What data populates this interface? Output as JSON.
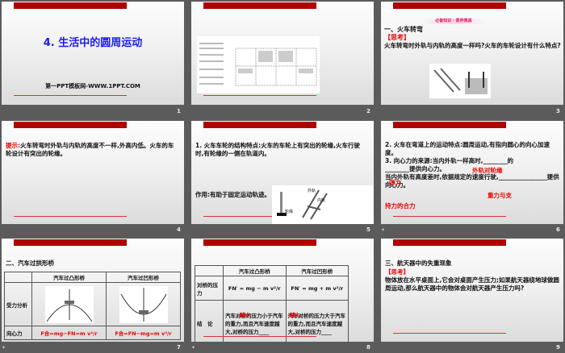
{
  "slides": [
    {
      "number": "1",
      "title": "4. 生活中的圆周运动",
      "subtitle": "第一PPT模板网-WWW.1PPT.COM"
    },
    {
      "number": "2"
    },
    {
      "number": "3",
      "banner": "必备知识 · 素养奠基",
      "heading": "一、火车转弯",
      "think": "【思考】",
      "question": "火车转弯时外轨与内轨的高度一样吗?火车的车轮设计有什么特点?"
    },
    {
      "number": "4",
      "hint_label": "提示:",
      "hint": "火车转弯时外轨与内轨的高度不一样,外高内低。火车的车轮设计有突出的轮缘。"
    },
    {
      "number": "5",
      "text": "1. 火车车轮的结构特点:火车的车轮上有突出的轮缘,火车行驶时,有轮缘的一侧在轨道内。",
      "effect": "作用:有助于固定运动轨迹。",
      "label_outer": "外轨",
      "label_inner": "内轨",
      "label_flange": "轮缘"
    },
    {
      "number": "6",
      "line1": "2. 火车在弯道上的运动特点:圆周运动,有指向圆心的向心加速度。",
      "line2": "3. 向心力的来源:当内外轨一样高时,________的________提供向心力。",
      "line3": "当内外轨有高度差时,依据规定的速度行驶,________________提供向心力。",
      "ans1": "外轨对轮缘",
      "ans2": "弹力",
      "ans3a": "重力与支",
      "ans3b": "持力的合力"
    },
    {
      "number": "7",
      "heading": "二、汽车过拱形桥",
      "col1": "汽车过凸形桥",
      "col2": "汽车过凹形桥",
      "row1": "受力分析",
      "row2": "向心力",
      "f1": "F合=mg−FN=m v²/r",
      "f2": "F合=FN−mg=m v²/r"
    },
    {
      "number": "8",
      "col1": "汽车过凸形桥",
      "col2": "汽车过凹形桥",
      "row1": "对桥的压力",
      "row2": "结　论",
      "p1": "FN′ = mg − m v²/r",
      "p2": "FN′ = mg + m v²/r",
      "c1": "汽车对桥的压力小于汽车的重力,而且汽车速度越大,对桥的压力____",
      "c2": "汽车对桥的压力大于汽车的重力,而且汽车速度越大,对桥的压力____",
      "a1": "越小",
      "a2": "越大"
    },
    {
      "number": "9",
      "heading": "三、航天器中的失重现象",
      "think": "【思考】",
      "question": "物体放在水平桌面上,它会对桌面产生压力;如果航天器绕地球做圆周运动,那么航天器中的物体会对航天器产生压力吗?"
    }
  ],
  "colors": {
    "accent": "#b00000",
    "title": "#1a1aff",
    "answer": "#e00000"
  }
}
